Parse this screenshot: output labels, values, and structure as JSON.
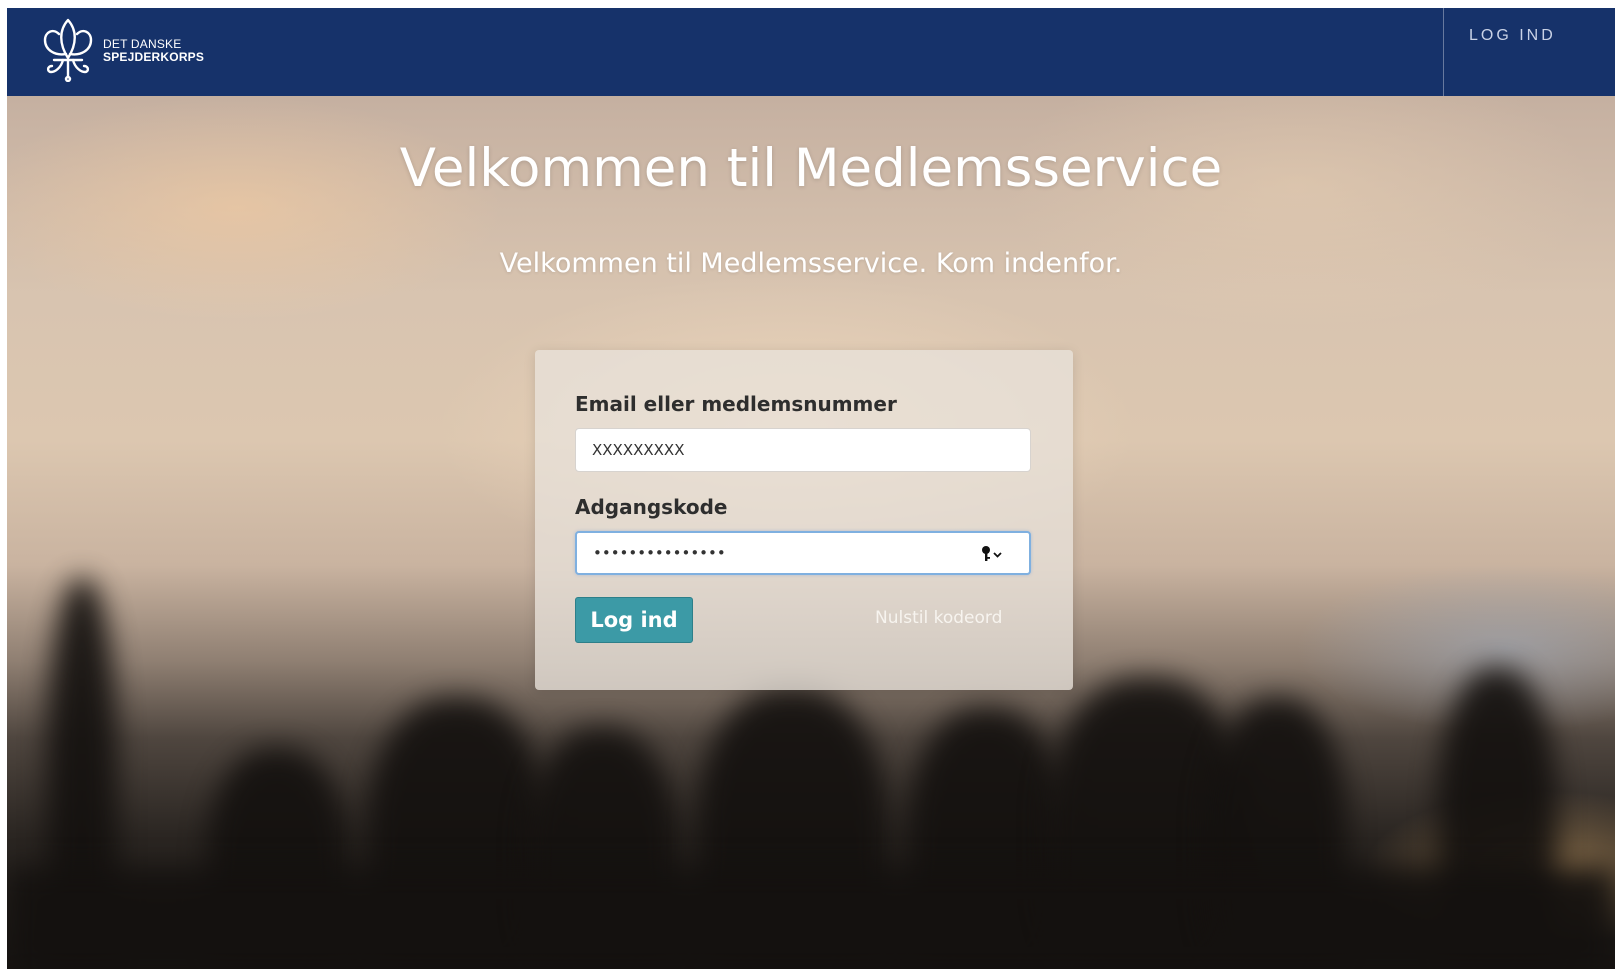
{
  "header": {
    "logo_line1": "DET DANSKE",
    "logo_line2": "SPEJDERKORPS",
    "login_label": "LOG IND"
  },
  "main": {
    "title": "Velkommen til Medlemsservice",
    "subtitle": "Velkommen til Medlemsservice. Kom indenfor."
  },
  "form": {
    "email_label": "Email eller medlemsnummer",
    "email_value": "XXXXXXXXX",
    "password_label": "Adgangskode",
    "password_value": "•••••••••••••••",
    "submit_label": "Log ind",
    "reset_label": "Nulstil kodeord"
  },
  "colors": {
    "header_bg": "#16326a",
    "button_bg": "#3c9aa6",
    "focus_border": "#7fb0e0"
  },
  "icons": {
    "logo": "fleur-de-lis-icon",
    "password_manager": "key-icon"
  }
}
